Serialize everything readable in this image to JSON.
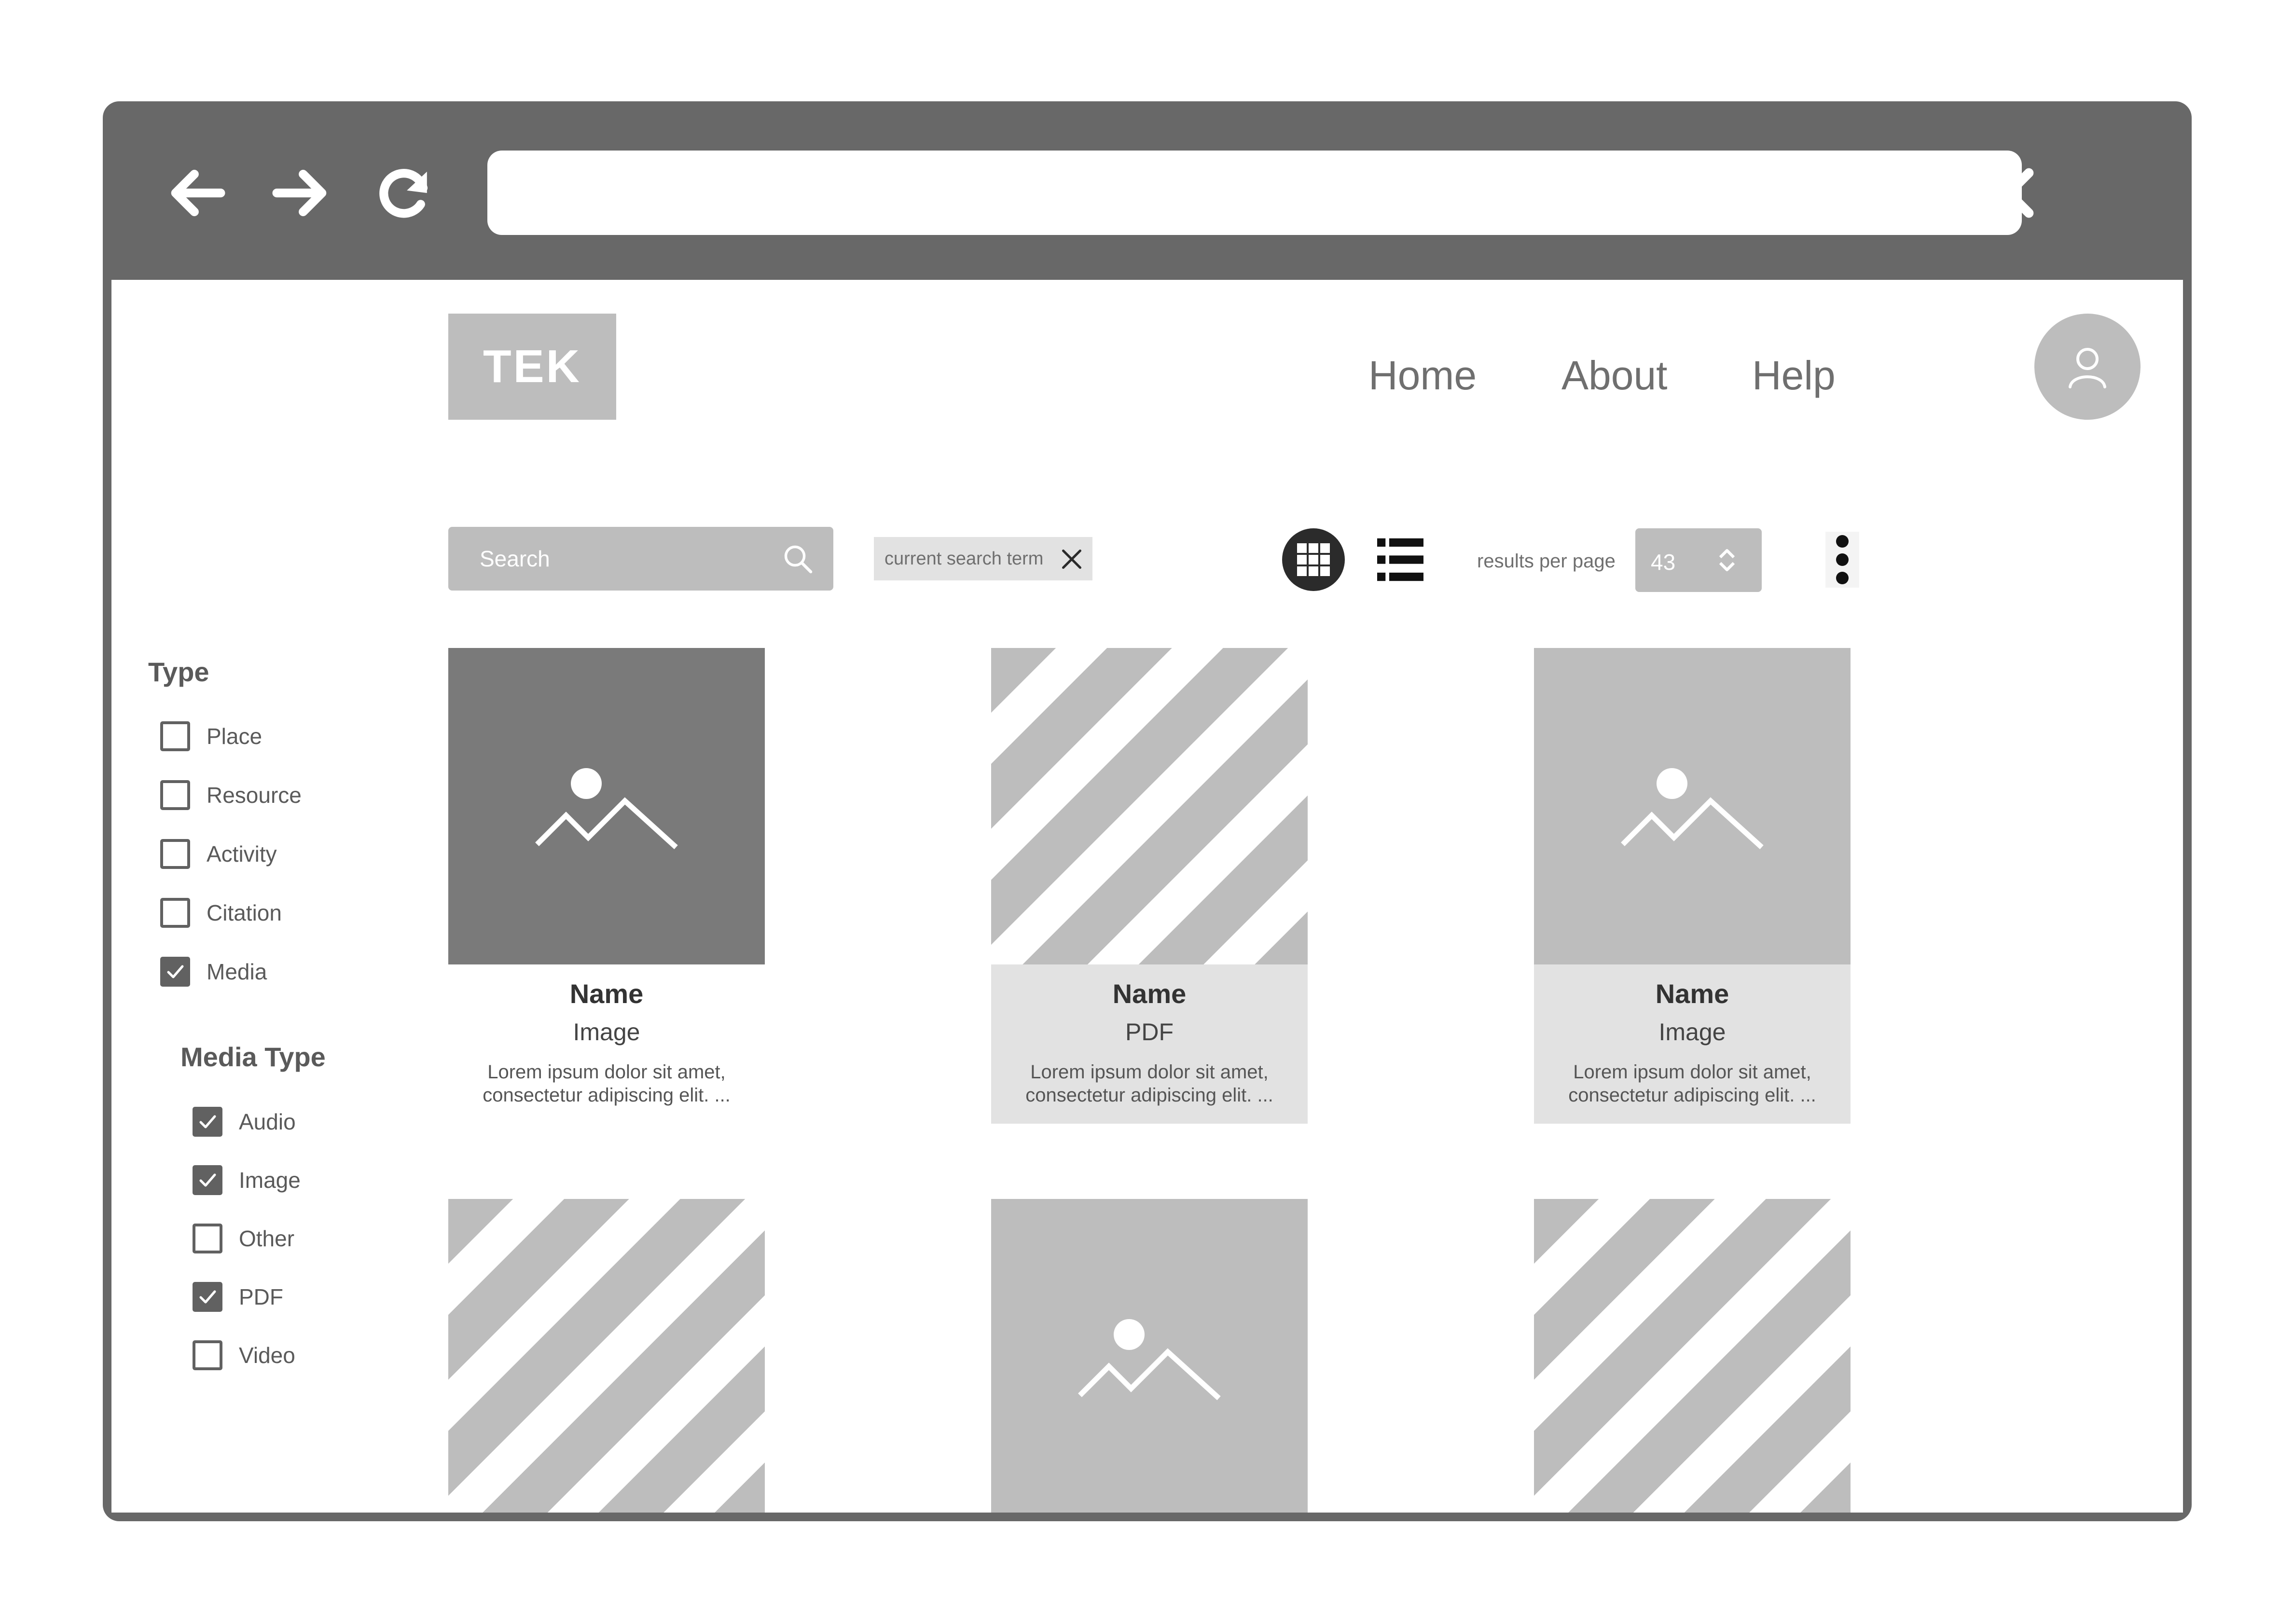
{
  "browser": {
    "address": ""
  },
  "header": {
    "logo": "TEK",
    "nav": [
      "Home",
      "About",
      "Help"
    ]
  },
  "toolbar": {
    "search_placeholder": "Search",
    "search_chip": "current search term",
    "results_per_page_label": "results per page",
    "results_per_page_value": "43"
  },
  "filters": {
    "type": {
      "heading": "Type",
      "items": [
        {
          "label": "Place",
          "checked": false
        },
        {
          "label": "Resource",
          "checked": false
        },
        {
          "label": "Activity",
          "checked": false
        },
        {
          "label": "Citation",
          "checked": false
        },
        {
          "label": "Media",
          "checked": true
        }
      ]
    },
    "media_type": {
      "heading": "Media Type",
      "items": [
        {
          "label": "Audio",
          "checked": true
        },
        {
          "label": "Image",
          "checked": true
        },
        {
          "label": "Other",
          "checked": false
        },
        {
          "label": "PDF",
          "checked": true
        },
        {
          "label": "Video",
          "checked": false
        }
      ]
    }
  },
  "results": [
    {
      "thumb": "image-dark",
      "name": "Name",
      "type": "Image",
      "description": "Lorem ipsum dolor sit amet, consectetur adipiscing elit. ..."
    },
    {
      "thumb": "striped",
      "name": "Name",
      "type": "PDF",
      "description": "Lorem ipsum dolor sit amet, consectetur adipiscing elit. ..."
    },
    {
      "thumb": "image-light",
      "name": "Name",
      "type": "Image",
      "description": "Lorem ipsum dolor sit amet, consectetur adipiscing elit. ..."
    },
    {
      "thumb": "striped"
    },
    {
      "thumb": "image-light"
    },
    {
      "thumb": "striped"
    }
  ],
  "icons": {
    "back": "arrow-left-icon",
    "forward": "arrow-right-icon",
    "reload": "reload-icon",
    "close": "close-icon",
    "user": "user-icon",
    "search": "search-icon",
    "grid": "grid-view-icon",
    "list": "list-view-icon",
    "more": "more-vertical-icon",
    "image": "image-placeholder-icon"
  },
  "colors": {
    "chrome": "#686868",
    "placeholder_gray": "#bdbdbd",
    "dark_gray": "#7a7a7a",
    "card_shade": "#e2e2e2",
    "checkbox": "#616161"
  }
}
